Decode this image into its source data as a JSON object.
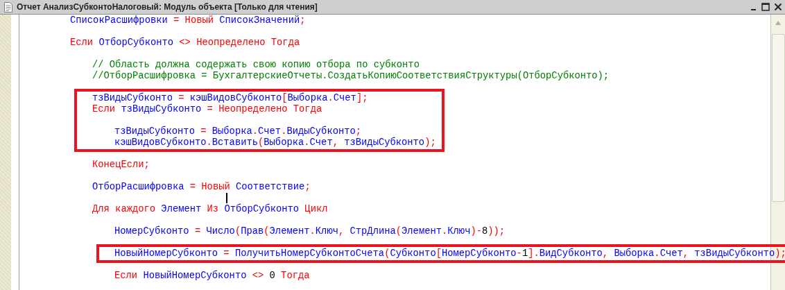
{
  "window": {
    "title": "Отчет АнализСубконтоНалоговый: Модуль объекта [Только для чтения]"
  },
  "code": [
    {
      "space_before": false,
      "boxed": false,
      "tokens": [
        {
          "kind": "name",
          "text": "СписокРасшифровки"
        },
        {
          "kind": "op",
          "text": " = "
        },
        {
          "kind": "kw",
          "text": "Новый"
        },
        {
          "kind": "name",
          "text": " СписокЗначений"
        },
        {
          "kind": "op",
          "text": ";"
        }
      ]
    },
    {
      "space_before": true,
      "boxed": false,
      "tokens": [
        {
          "kind": "kw",
          "text": "Если"
        },
        {
          "kind": "name",
          "text": " ОтборСубконто"
        },
        {
          "kind": "op",
          "text": " <> "
        },
        {
          "kind": "kw",
          "text": "Неопределено Тогда"
        }
      ],
      "children": [
        {
          "space_before": true,
          "boxed": false,
          "tokens": [
            {
              "kind": "comment",
              "text": "// Область должна содержать свою копию отбора по субконто"
            }
          ]
        },
        {
          "space_before": false,
          "boxed": false,
          "tokens": [
            {
              "kind": "comment",
              "text": "//ОтборРасшифровка = БухгалтерскиеОтчеты.СоздатьКопиюСоответствияСтруктуры(ОтборСубконто);"
            }
          ]
        },
        {
          "space_before": true,
          "boxed": true,
          "tokens": [
            {
              "kind": "name",
              "text": "тзВидыСубконто"
            },
            {
              "kind": "op",
              "text": " = "
            },
            {
              "kind": "name",
              "text": "кэшВидовСубконто"
            },
            {
              "kind": "op",
              "text": "["
            },
            {
              "kind": "name",
              "text": "Выборка"
            },
            {
              "kind": "op",
              "text": "."
            },
            {
              "kind": "name",
              "text": "Счет"
            },
            {
              "kind": "op",
              "text": "];"
            }
          ]
        },
        {
          "space_before": false,
          "boxed": true,
          "tokens": [
            {
              "kind": "kw",
              "text": "Если"
            },
            {
              "kind": "name",
              "text": " тзВидыСубконто"
            },
            {
              "kind": "op",
              "text": " = "
            },
            {
              "kind": "kw",
              "text": "Неопределено Тогда"
            }
          ],
          "children": [
            {
              "space_before": true,
              "boxed": true,
              "tokens": [
                {
                  "kind": "name",
                  "text": "тзВидыСубконто"
                },
                {
                  "kind": "op",
                  "text": " = "
                },
                {
                  "kind": "name",
                  "text": "Выборка"
                },
                {
                  "kind": "op",
                  "text": "."
                },
                {
                  "kind": "name",
                  "text": "Счет"
                },
                {
                  "kind": "op",
                  "text": "."
                },
                {
                  "kind": "name",
                  "text": "ВидыСубконто"
                },
                {
                  "kind": "op",
                  "text": ";"
                }
              ]
            },
            {
              "space_before": false,
              "boxed": true,
              "tokens": [
                {
                  "kind": "name",
                  "text": "кэшВидовСубконто"
                },
                {
                  "kind": "op",
                  "text": "."
                },
                {
                  "kind": "name",
                  "text": "Вставить"
                },
                {
                  "kind": "op",
                  "text": "("
                },
                {
                  "kind": "name",
                  "text": "Выборка"
                },
                {
                  "kind": "op",
                  "text": "."
                },
                {
                  "kind": "name",
                  "text": "Счет"
                },
                {
                  "kind": "op",
                  "text": ", "
                },
                {
                  "kind": "name",
                  "text": "тзВидыСубконто"
                },
                {
                  "kind": "op",
                  "text": ");"
                }
              ]
            }
          ]
        },
        {
          "space_before": true,
          "boxed": false,
          "tokens": [
            {
              "kind": "kw",
              "text": "КонецЕсли"
            },
            {
              "kind": "op",
              "text": ";"
            }
          ]
        },
        {
          "space_before": true,
          "boxed": false,
          "tokens": [
            {
              "kind": "name",
              "text": "ОтборРасшифровка"
            },
            {
              "kind": "op",
              "text": " = "
            },
            {
              "kind": "kw",
              "text": "Новый"
            },
            {
              "kind": "name",
              "text": " Соответствие"
            },
            {
              "kind": "op",
              "text": ";"
            }
          ]
        },
        {
          "space_before": true,
          "boxed": false,
          "tokens": [
            {
              "kind": "kw",
              "text": "Для каждого"
            },
            {
              "kind": "name",
              "text": " Элемент "
            },
            {
              "kind": "kw",
              "text": "Из"
            },
            {
              "kind": "name",
              "text": " ОтборСубконто "
            },
            {
              "kind": "kw",
              "text": "Цикл"
            }
          ],
          "children": [
            {
              "space_before": true,
              "boxed": false,
              "tokens": [
                {
                  "kind": "name",
                  "text": "НомерСубконто"
                },
                {
                  "kind": "op",
                  "text": " = "
                },
                {
                  "kind": "name",
                  "text": "Число"
                },
                {
                  "kind": "op",
                  "text": "("
                },
                {
                  "kind": "name",
                  "text": "Прав"
                },
                {
                  "kind": "op",
                  "text": "("
                },
                {
                  "kind": "name",
                  "text": "Элемент"
                },
                {
                  "kind": "op",
                  "text": "."
                },
                {
                  "kind": "name",
                  "text": "Ключ"
                },
                {
                  "kind": "op",
                  "text": ", "
                },
                {
                  "kind": "name",
                  "text": "СтрДлина"
                },
                {
                  "kind": "op",
                  "text": "("
                },
                {
                  "kind": "name",
                  "text": "Элемент"
                },
                {
                  "kind": "op",
                  "text": "."
                },
                {
                  "kind": "name",
                  "text": "Ключ"
                },
                {
                  "kind": "op",
                  "text": ")-"
                },
                {
                  "kind": "num",
                  "text": "8"
                },
                {
                  "kind": "op",
                  "text": "));"
                }
              ]
            },
            {
              "space_before": true,
              "boxed": true,
              "tokens": [
                {
                  "kind": "name",
                  "text": "НовыйНомерСубконто"
                },
                {
                  "kind": "op",
                  "text": " = "
                },
                {
                  "kind": "name",
                  "text": "ПолучитьНомерСубконтоСчета"
                },
                {
                  "kind": "op",
                  "text": "("
                },
                {
                  "kind": "name",
                  "text": "Субконто"
                },
                {
                  "kind": "op",
                  "text": "["
                },
                {
                  "kind": "name",
                  "text": "НомерСубконто"
                },
                {
                  "kind": "op",
                  "text": "-"
                },
                {
                  "kind": "num",
                  "text": "1"
                },
                {
                  "kind": "op",
                  "text": "]."
                },
                {
                  "kind": "name",
                  "text": "ВидСубконто"
                },
                {
                  "kind": "op",
                  "text": ", "
                },
                {
                  "kind": "name",
                  "text": "Выборка"
                },
                {
                  "kind": "op",
                  "text": "."
                },
                {
                  "kind": "name",
                  "text": "Счет"
                },
                {
                  "kind": "op",
                  "text": ", "
                },
                {
                  "kind": "name",
                  "text": "тзВидыСубконто"
                },
                {
                  "kind": "op",
                  "text": ");"
                }
              ]
            },
            {
              "space_before": true,
              "boxed": false,
              "tokens": [
                {
                  "kind": "kw",
                  "text": "Если"
                },
                {
                  "kind": "name",
                  "text": " НовыйНомерСубконто "
                },
                {
                  "kind": "op",
                  "text": "<> "
                },
                {
                  "kind": "num",
                  "text": "0"
                },
                {
                  "kind": "kw",
                  "text": " Тогда"
                }
              ]
            }
          ]
        }
      ]
    }
  ]
}
